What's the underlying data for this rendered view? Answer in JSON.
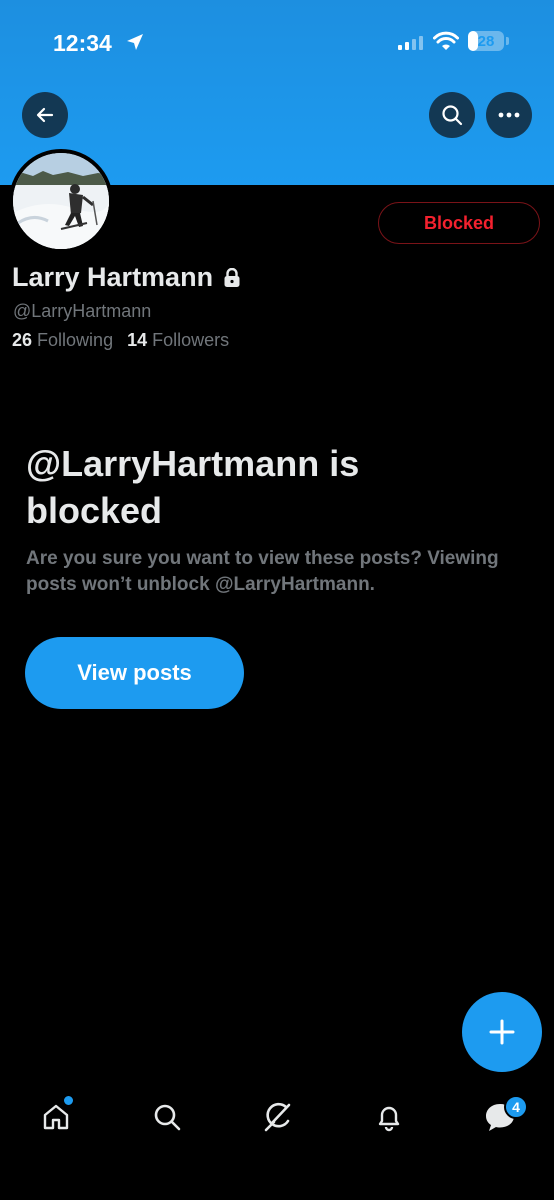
{
  "status_bar": {
    "time": "12:34",
    "battery_level": "28",
    "battery_fraction": 0.28,
    "icons": [
      "location-arrow-icon",
      "cellular-signal-icon",
      "wifi-icon",
      "battery-icon"
    ]
  },
  "header": {
    "back_icon": "arrow-left-icon",
    "search_icon": "search-icon",
    "more_icon": "more-horizontal-icon",
    "banner_color": "#1d9bf0"
  },
  "profile": {
    "name": "Larry Hartmann",
    "handle": "@LarryHartmann",
    "protected_icon": "lock-icon",
    "following_count": "26",
    "following_label": "Following",
    "followers_count": "14",
    "followers_label": "Followers",
    "blocked_button_label": "Blocked",
    "blocked_color": "#f4212e"
  },
  "blocked_notice": {
    "title": "@LarryHartmann is blocked",
    "subtitle": "Are you sure you want to view these posts? Viewing posts won’t unblock @LarryHartmann.",
    "view_button_label": "View posts"
  },
  "fab": {
    "icon": "plus-icon"
  },
  "bottom_nav": {
    "items": [
      "home-icon",
      "search-icon",
      "grok-icon",
      "notifications-bell-icon",
      "messages-icon"
    ],
    "messages_badge": "4"
  },
  "colors": {
    "accent": "#1d9bf0",
    "background": "#000000",
    "muted_text": "#71767b"
  }
}
